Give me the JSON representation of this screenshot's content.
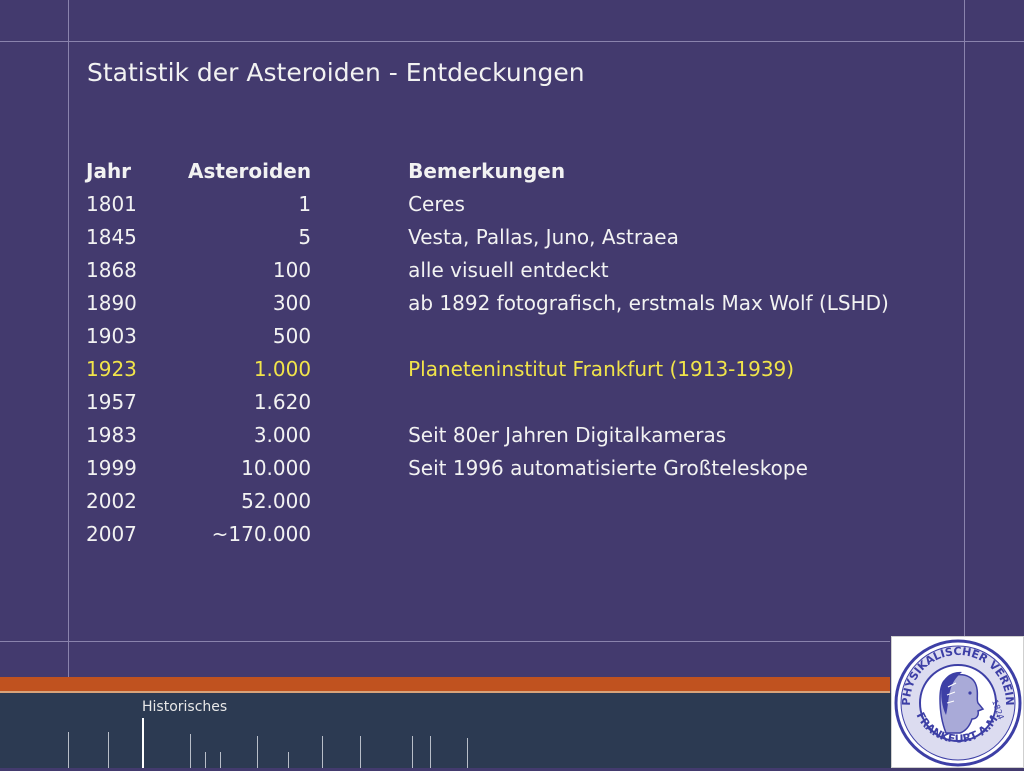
{
  "slide": {
    "title": "Statistik der Asteroiden - Entdeckungen",
    "footer_label": "Historisches"
  },
  "table": {
    "headers": {
      "year": "Jahr",
      "count": "Asteroiden",
      "note": "Bemerkungen"
    },
    "rows": [
      {
        "year": "1801",
        "count": "1",
        "note": "Ceres"
      },
      {
        "year": "1845",
        "count": "5",
        "note": "Vesta, Pallas, Juno, Astraea"
      },
      {
        "year": "1868",
        "count": "100",
        "note": "alle visuell entdeckt"
      },
      {
        "year": "1890",
        "count": "300",
        "note": "ab 1892 fotografisch, erstmals Max Wolf (LSHD)"
      },
      {
        "year": "1903",
        "count": "500",
        "note": ""
      },
      {
        "year": "1923",
        "count": "1.000",
        "note": "Planeteninstitut Frankfurt (1913-1939)"
      },
      {
        "year": "1957",
        "count": "1.620",
        "note": ""
      },
      {
        "year": "1983",
        "count": "3.000",
        "note": "Seit 80er Jahren Digitalkameras"
      },
      {
        "year": "1999",
        "count": "10.000",
        "note": "Seit 1996 automatisierte Großteleskope"
      },
      {
        "year": "2002",
        "count": "52.000",
        "note": ""
      },
      {
        "year": "2007",
        "count": "~170.000",
        "note": ""
      }
    ],
    "highlight_color": "#f1e44a"
  },
  "logo": {
    "text_top": "PHYSIKALISCHER VEREIN",
    "text_bottom": "FRANKFURT A.M.",
    "year": "1824"
  },
  "colors": {
    "background": "#433a6e",
    "accent_bar": "#c0521f",
    "footer": "#2c3a52",
    "seal_blue": "#3d3fa6"
  }
}
